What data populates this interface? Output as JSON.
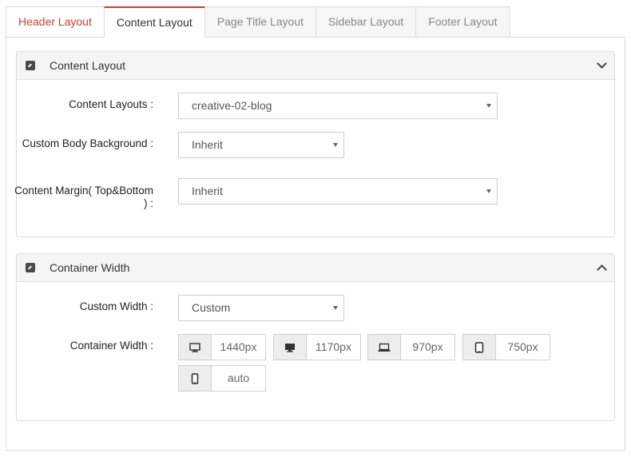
{
  "tabs": [
    {
      "label": "Header Layout"
    },
    {
      "label": "Content Layout"
    },
    {
      "label": "Page Title Layout"
    },
    {
      "label": "Sidebar Layout"
    },
    {
      "label": "Footer Layout"
    }
  ],
  "content_panel": {
    "title": "Content Layout",
    "fields": {
      "content_layouts": {
        "label": "Content Layouts :",
        "value": "creative-02-blog"
      },
      "custom_body_background": {
        "label": "Custom Body Background :",
        "value": "Inherit"
      },
      "content_margin": {
        "label": "Content Margin( Top&Bottom ) :",
        "value": "Inherit"
      }
    }
  },
  "container_panel": {
    "title": "Container Width",
    "custom_width": {
      "label": "Custom Width :",
      "value": "Custom"
    },
    "container_width": {
      "label": "Container Width :",
      "breakpoints": [
        {
          "icon": "desktop-icon",
          "value": "1440px"
        },
        {
          "icon": "monitor-icon",
          "value": "1170px"
        },
        {
          "icon": "laptop-icon",
          "value": "970px"
        },
        {
          "icon": "tablet-icon",
          "value": "750px"
        },
        {
          "icon": "mobile-icon",
          "value": "auto"
        }
      ]
    }
  }
}
